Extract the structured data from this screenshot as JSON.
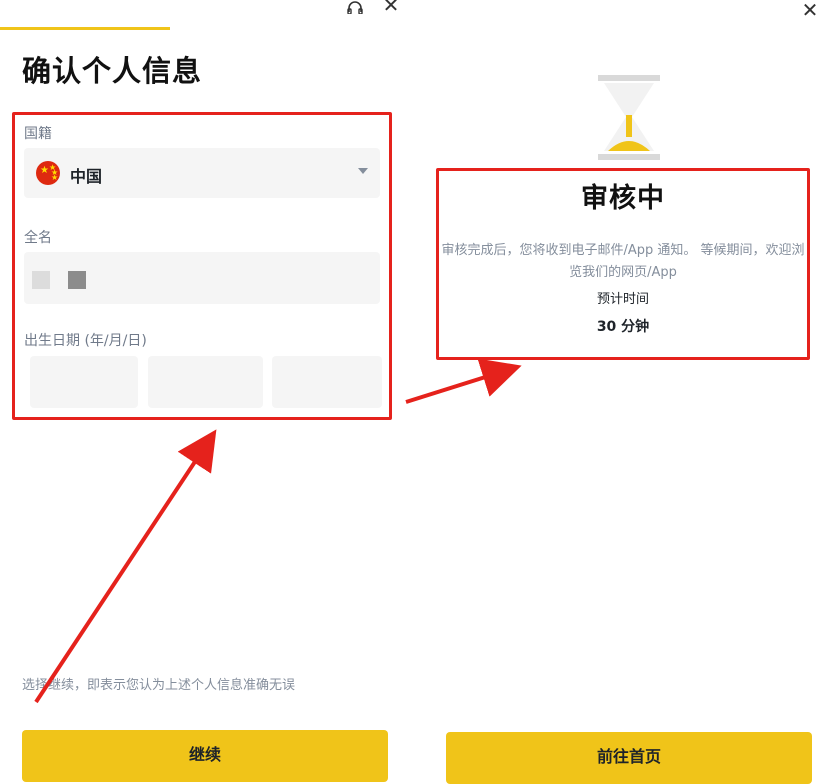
{
  "left": {
    "title": "确认个人信息",
    "nationality_label": "国籍",
    "nationality_value": "中国",
    "fullname_label": "全名",
    "dob_label": "出生日期 (年/月/日)",
    "consent_text": "选择继续，即表示您认为上述个人信息准确无误",
    "continue_label": "继续",
    "close_glyph": "✕"
  },
  "right": {
    "status_title": "审核中",
    "description": "审核完成后，您将收到电子邮件/App 通知。 等候期间，欢迎浏览我们的网页/App",
    "estimate_label": "预计时间",
    "estimate_value": "30 分钟",
    "home_label": "前往首页",
    "close_glyph": "✕"
  },
  "colors": {
    "accent": "#f0c419",
    "annotation_red": "#e5221c",
    "field_bg": "#f5f5f5"
  },
  "icons": [
    "headset-icon",
    "close-icon",
    "china-flag-icon",
    "chevron-down-icon",
    "hourglass-icon"
  ]
}
